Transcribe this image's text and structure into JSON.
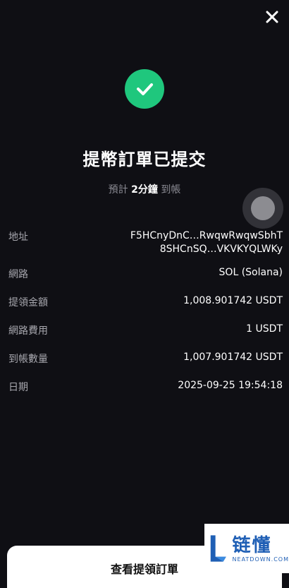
{
  "header": {
    "close_icon": "close-icon"
  },
  "status": {
    "icon": "check-icon",
    "color": "#1fc77d",
    "title": "提幣訂單已提交",
    "eta_prefix": "預計",
    "eta_value": "2分鐘",
    "eta_suffix": "到帳"
  },
  "details": {
    "address_label": "地址",
    "address_line1": "F5HCnyDnC…RwqwRwqwSbhT",
    "address_line2": "8SHCnSQ…VKVKYQLWKy",
    "network_label": "網路",
    "network_value": "SOL (Solana)",
    "amount_label": "提領金額",
    "amount_value": "1,008.901742 USDT",
    "fee_label": "網路費用",
    "fee_value": "1 USDT",
    "received_label": "到帳數量",
    "received_value": "1,007.901742 USDT",
    "date_label": "日期",
    "date_value": "2025-09-25 19:54:18"
  },
  "footer": {
    "view_orders_label": "查看提領訂單"
  },
  "watermark": {
    "cn": "链懂",
    "en": "NEATDOWN.COM"
  }
}
